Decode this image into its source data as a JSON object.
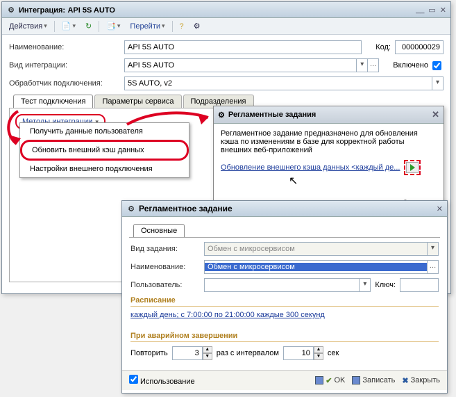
{
  "main": {
    "title_prefix": "Интеграция:",
    "title_name": "API 5S AUTO",
    "toolbar": {
      "actions": "Действия",
      "goto": "Перейти"
    },
    "labels": {
      "name": "Наименование:",
      "kind": "Вид интеграции:",
      "handler": "Обработчик подключения:",
      "code": "Код:",
      "enabled": "Включено"
    },
    "values": {
      "name": "API 5S AUTO",
      "kind": "API 5S AUTO",
      "handler": "5S AUTO, v2",
      "code": "000000029",
      "enabled": true
    },
    "tabs": [
      "Тест подключения",
      "Параметры сервиса",
      "Подразделения"
    ],
    "menu_trigger": "Методы интеграции",
    "menu_items": [
      "Получить данные пользователя",
      "Обновить внешний кэш данных",
      "Настройки внешнего подключения"
    ]
  },
  "sched_popup": {
    "title": "Регламентные задания",
    "text": "Регламентное задание предназначено для обновления кэша по изменениям в базе для корректной работы внешних веб-приложений",
    "link": "Обновление внешнего кэша данных <каждый де...",
    "close": "Закрыть"
  },
  "job_window": {
    "title": "Регламентное задание",
    "tab": "Основные",
    "labels": {
      "kind": "Вид задания:",
      "name": "Наименование:",
      "user": "Пользователь:",
      "key": "Ключ:"
    },
    "values": {
      "kind": "Обмен с микросервисом",
      "name": "Обмен с микросервисом",
      "user": "",
      "key": ""
    },
    "schedule_head": "Расписание",
    "schedule_link": "каждый день; с 7:00:00 по 21:00:00 каждые 300 секунд",
    "crash_head": "При аварийном завершении",
    "repeat": "Повторить",
    "repeat_n": "3",
    "times_word": "раз с интервалом",
    "interval": "10",
    "sec": "сек",
    "use": "Использование",
    "buttons": {
      "ok": "OK",
      "save": "Записать",
      "close": "Закрыть"
    }
  }
}
